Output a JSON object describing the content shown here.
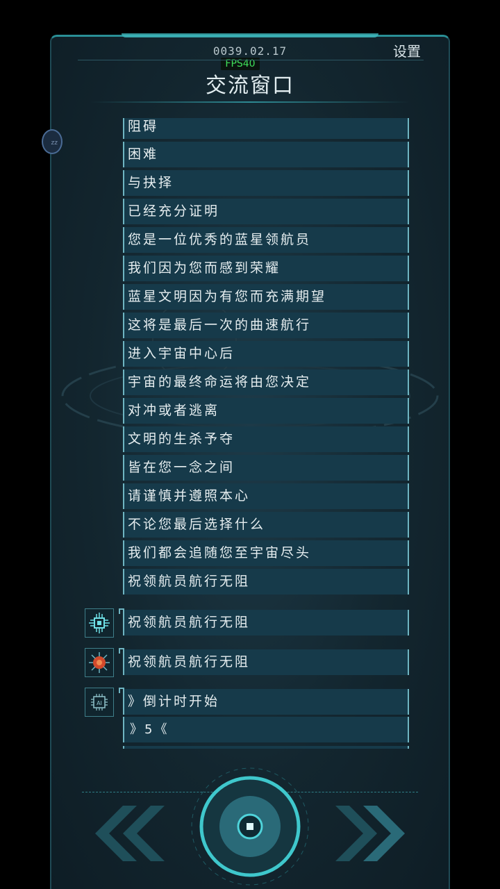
{
  "header": {
    "date": "0039.02.17",
    "fps": "FPS40",
    "settings_label": "设置",
    "title": "交流窗口",
    "side_icon_text": "zz"
  },
  "messages": [
    "阻碍",
    "困难",
    "与抉择",
    "已经充分证明",
    "您是一位优秀的蓝星领航员",
    "我们因为您而感到荣耀",
    "蓝星文明因为有您而充满期望",
    "这将是最后一次的曲速航行",
    "进入宇宙中心后",
    "宇宙的最终命运将由您决定",
    "对冲或者逃离",
    "文明的生杀予夺",
    "皆在您一念之间",
    "请谨慎并遵照本心",
    "不论您最后选择什么",
    "我们都会追随您至宇宙尽头",
    "祝领航员航行无阻"
  ],
  "chat": [
    {
      "avatar": "cyan-chip-icon",
      "text": "祝领航员航行无阻"
    },
    {
      "avatar": "red-chip-icon",
      "text": "祝领航员航行无阻"
    },
    {
      "avatar": "ai-chip-icon",
      "text": "》倒计时开始"
    }
  ],
  "countdown_text": "》5《",
  "controls": {
    "left": "double-chevron-left-icon",
    "center": "center-button",
    "right": "double-chevron-right-icon"
  },
  "colors": {
    "accent": "#3fb7bb",
    "fps": "#3fe05a",
    "row_bg": "#163a4a"
  }
}
